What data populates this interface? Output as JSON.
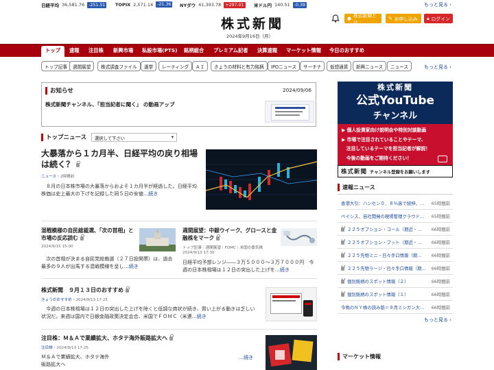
{
  "ticker": [
    {
      "name": "日経平均",
      "value": "36,581.76",
      "change": "-251.51",
      "dir": "down"
    },
    {
      "name": "TOPIX",
      "value": "2,571.14",
      "change": "-21.36",
      "dir": "down"
    },
    {
      "name": "NYダウ",
      "value": "41,393.78",
      "change": "+297.01",
      "dir": "up"
    },
    {
      "name": "米ドル円",
      "value": "140.51",
      "change": "-0.39",
      "dir": "down"
    }
  ],
  "ticker_more": "もっと見る",
  "header": {
    "logo": "株式新聞",
    "date": "2024年9月16日（月）",
    "about": "株式新聞とは",
    "signup": "お申し込み",
    "login": "ログイン"
  },
  "nav": [
    "トップ",
    "速報",
    "注目株",
    "新興市場",
    "私設市場(PTS)",
    "銘柄総合",
    "プレミアム記者",
    "決算速報",
    "マーケット情報",
    "今日のおすすめ"
  ],
  "tags": [
    "トップ記事",
    "週間展望",
    "株式調査ファイル",
    "選挙",
    "レーティング",
    "ＡＩ",
    "きょうの材料と有力銘柄",
    "IPOニュース",
    "サーチナ",
    "仮想通貨",
    "新興ニュース",
    "ニュース"
  ],
  "tags_more": "もっと見る",
  "notice": {
    "title": "お知らせ",
    "date": "2024/09/06",
    "text": "株式新聞チャンネル、「担当記者に聞く」 の動画アップ"
  },
  "topnews": {
    "title": "トップニュース",
    "select": "選択して下さい",
    "lead": {
      "headline": "大暴落から１カ月半、日経平均の戻り相場は続く？",
      "meta_cat": "ニュース",
      "meta_time": "2時間前",
      "body": "　８月の日本株市場の大暴落からおよそ１カ月半が経過した。日経平均株価は史上最大の下げを記録した同５日の安値",
      "more": "続き"
    },
    "items": [
      {
        "headline": "混戦模様の自民総裁選、「次の首相」と市場の反応読む",
        "meta": "2024/9/15 15:00",
        "body": "　次の首相が決まる自民党総裁選（２７日投開票）は、過去最多の９人が出馬する混戦模様を呈し",
        "more": "続き"
      },
      {
        "headline": "週間展望：中銀ウイーク、グロースと金融株をマーク",
        "meta_tags": "トップ記事｜週間展望｜FOMC｜米国の景気株",
        "meta": "2024/9/13 17:30",
        "body": "日経平均予想レンジ――３万５０００～３万７０００円　今週の日本株相場は１２日の突出した上げを",
        "more": "続き"
      },
      {
        "headline": "株式新聞　９月１３日のおすすめ",
        "meta_cat": "きょうのおすすめ",
        "meta": "2024/9/13 17:25",
        "body": "　今週の日本株相場は１２日の突出した上げを除くと低調な商状が続き、買い上がる動きは乏しい状況だ。来週は国内で日銀金融政策決定会合、米国でＦＯＭＣ（米連",
        "more": "続き"
      },
      {
        "headline": "注目株：Ｍ＆Ａで業績拡大、ホタテ海外販路拡大へ",
        "meta_cat": "注目株",
        "meta": "2024/9/13 17:25",
        "body": "Ｍ＆Ａで業績拡大、ホタテ海外販路拡大へ",
        "more": "続き"
      }
    ]
  },
  "side": {
    "yt": {
      "top": "株式新聞",
      "big1": "公式YouTube",
      "big2": "チャンネル",
      "b1": "個人投資家向け説明会や特別対談動画",
      "b2": "市場で注目されていることやテーマ、",
      "b3": "注目しているテーマを担当記者が解説！",
      "b4": "今後の動画をご期待ください！",
      "foot_logo": "株式新聞",
      "foot": "チャンネル登録をお願いします"
    },
    "flash_title": "速報ニュース",
    "flash": [
      {
        "t": "香港大引：ハンセン０．８％高で続伸、…",
        "m": "65時間前"
      },
      {
        "t": "ベイシス、自社開発の現場管理クラウド…",
        "m": "65時間前"
      },
      {
        "t": "２２５オプション・コール（期近・…",
        "m": "66時間前"
      },
      {
        "t": "２２５オプション・プット（期近・…",
        "m": "66時間前"
      },
      {
        "t": "２２５先物ミニ・日々手口情報（期…",
        "m": "66時間前"
      },
      {
        "t": "２２５先物ラージ・日々手口情報（期…",
        "m": "66時間前"
      },
      {
        "t": "個別銘柄のスポット情報（２）",
        "m": "66時間前"
      },
      {
        "t": "個別銘柄のスポット情報（１）",
        "m": "66時間前"
      },
      {
        "t": "今晩のＮＹ株の読み筋＝９月ミシガン大…",
        "m": "66時間前"
      }
    ],
    "flash_more": "もっと見る",
    "market_title": "マーケット情報"
  },
  "colors": {
    "brand": "#a8000d",
    "link": "#1a4a9a",
    "down": "#2b5bb0",
    "up": "#d6282b"
  }
}
